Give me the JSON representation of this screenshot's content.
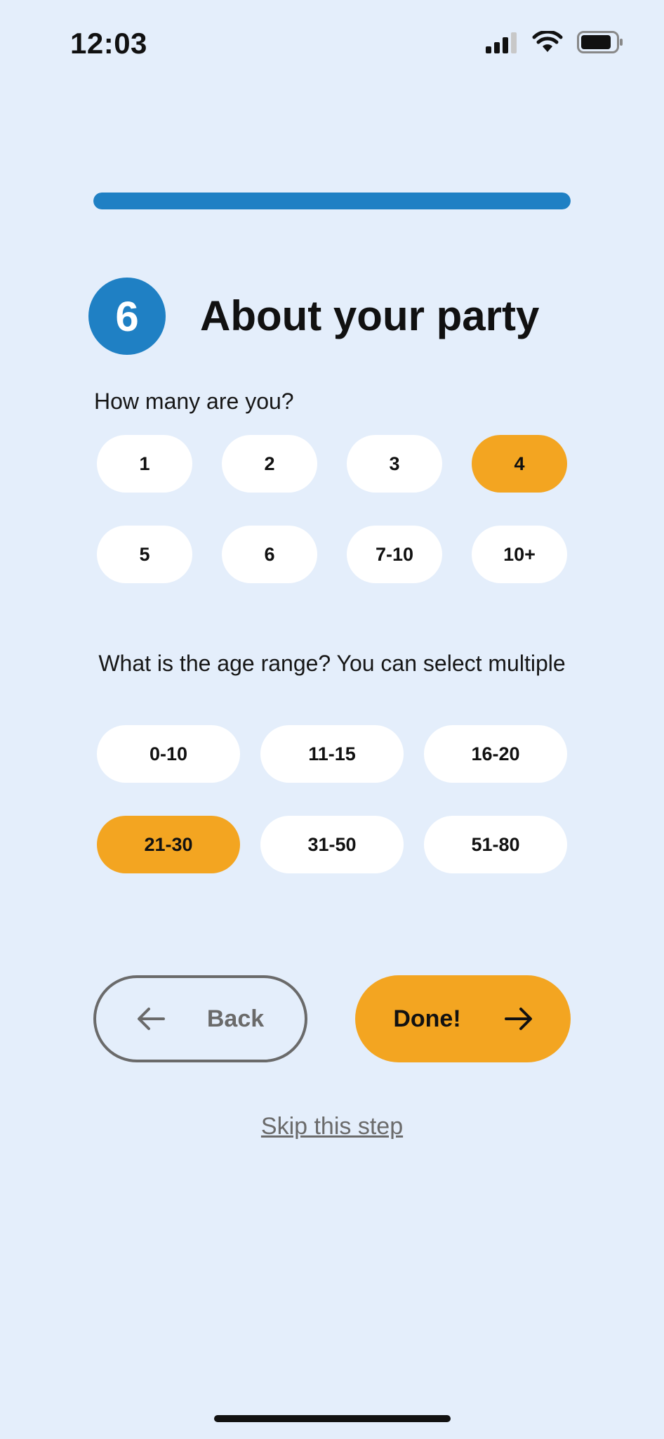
{
  "status_bar": {
    "time": "12:03"
  },
  "progress": {
    "fraction": 1.0
  },
  "step": {
    "number": "6",
    "title": "About your party"
  },
  "party_size": {
    "question": "How many are you?",
    "options": [
      {
        "label": "1",
        "selected": false
      },
      {
        "label": "2",
        "selected": false
      },
      {
        "label": "3",
        "selected": false
      },
      {
        "label": "4",
        "selected": true
      },
      {
        "label": "5",
        "selected": false
      },
      {
        "label": "6",
        "selected": false
      },
      {
        "label": "7-10",
        "selected": false
      },
      {
        "label": "10+",
        "selected": false
      }
    ]
  },
  "age_range": {
    "question": "What is the age range? You can select multiple",
    "options": [
      {
        "label": "0-10",
        "selected": false
      },
      {
        "label": "11-15",
        "selected": false
      },
      {
        "label": "16-20",
        "selected": false
      },
      {
        "label": "21-30",
        "selected": true
      },
      {
        "label": "31-50",
        "selected": false
      },
      {
        "label": "51-80",
        "selected": false
      }
    ]
  },
  "actions": {
    "back_label": "Back",
    "done_label": "Done!",
    "skip_label": "Skip this step"
  },
  "colors": {
    "accent": "#1f80c4",
    "selected": "#f3a521",
    "background": "#e4eefb"
  },
  "icons": {
    "back": "arrow-left-icon",
    "done": "arrow-right-icon"
  }
}
